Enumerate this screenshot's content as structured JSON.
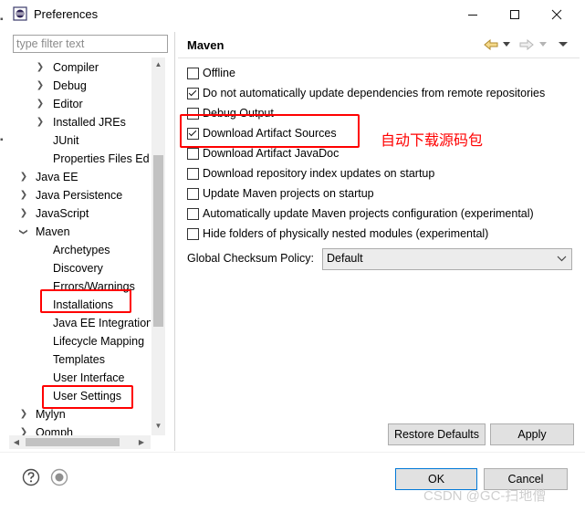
{
  "window": {
    "title": "Preferences"
  },
  "sidebar": {
    "filter_placeholder": "type filter text",
    "tree": [
      {
        "label": "Compiler",
        "level": 2,
        "twisty": "collapsed"
      },
      {
        "label": "Debug",
        "level": 2,
        "twisty": "collapsed"
      },
      {
        "label": "Editor",
        "level": 2,
        "twisty": "collapsed"
      },
      {
        "label": "Installed JREs",
        "level": 2,
        "twisty": "collapsed"
      },
      {
        "label": "JUnit",
        "level": 2,
        "twisty": "none"
      },
      {
        "label": "Properties Files Ed",
        "level": 2,
        "twisty": "none"
      },
      {
        "label": "Java EE",
        "level": 1,
        "twisty": "collapsed"
      },
      {
        "label": "Java Persistence",
        "level": 1,
        "twisty": "collapsed"
      },
      {
        "label": "JavaScript",
        "level": 1,
        "twisty": "collapsed"
      },
      {
        "label": "Maven",
        "level": 1,
        "twisty": "expanded"
      },
      {
        "label": "Archetypes",
        "level": 2,
        "twisty": "none"
      },
      {
        "label": "Discovery",
        "level": 2,
        "twisty": "none"
      },
      {
        "label": "Errors/Warnings",
        "level": 2,
        "twisty": "none"
      },
      {
        "label": "Installations",
        "level": 2,
        "twisty": "none"
      },
      {
        "label": "Java EE Integration",
        "level": 2,
        "twisty": "none"
      },
      {
        "label": "Lifecycle Mapping",
        "level": 2,
        "twisty": "none"
      },
      {
        "label": "Templates",
        "level": 2,
        "twisty": "none"
      },
      {
        "label": "User Interface",
        "level": 2,
        "twisty": "none"
      },
      {
        "label": "User Settings",
        "level": 2,
        "twisty": "none"
      },
      {
        "label": "Mylyn",
        "level": 1,
        "twisty": "collapsed"
      },
      {
        "label": "Oomph",
        "level": 1,
        "twisty": "collapsed"
      }
    ]
  },
  "main": {
    "title": "Maven",
    "options": [
      {
        "label": "Offline",
        "checked": false
      },
      {
        "label": "Do not automatically update dependencies from remote repositories",
        "checked": true
      },
      {
        "label": "Debug Output",
        "checked": false
      },
      {
        "label": "Download Artifact Sources",
        "checked": true
      },
      {
        "label": "Download Artifact JavaDoc",
        "checked": false
      },
      {
        "label": "Download repository index updates on startup",
        "checked": false
      },
      {
        "label": "Update Maven projects on startup",
        "checked": false
      },
      {
        "label": "Automatically update Maven projects configuration (experimental)",
        "checked": false
      },
      {
        "label": "Hide folders of physically nested modules (experimental)",
        "checked": false
      }
    ],
    "checksum_policy": {
      "label": "Global Checksum Policy:",
      "value": "Default"
    },
    "restore_defaults_label": "Restore Defaults",
    "apply_label": "Apply"
  },
  "footer": {
    "ok_label": "OK",
    "cancel_label": "Cancel"
  },
  "annotation": {
    "label": "自动下载源码包",
    "color": "#ff0000"
  },
  "watermark": "CSDN @GC-扫地僧",
  "colors": {
    "accent_border": "#0078d7",
    "button_face": "#e1e1e1"
  }
}
